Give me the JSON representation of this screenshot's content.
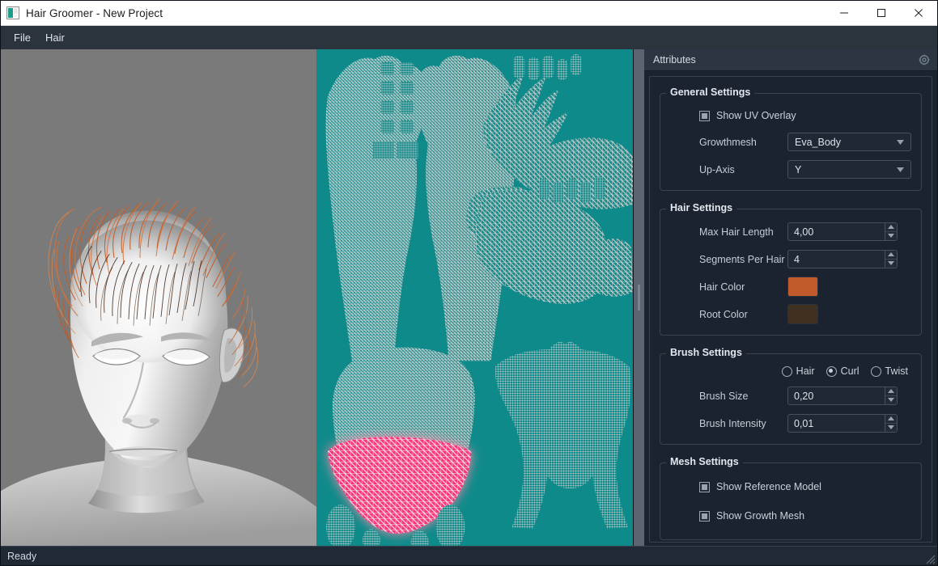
{
  "window": {
    "title": "Hair Groomer - New Project",
    "icon": "app-icon",
    "controls": {
      "minimize": "minimize-icon",
      "maximize": "maximize-icon",
      "close": "close-icon"
    }
  },
  "menubar": {
    "items": [
      {
        "label": "File"
      },
      {
        "label": "Hair"
      }
    ]
  },
  "viewport": {
    "name": "3d-viewport",
    "background_color": "#7a7a7a",
    "model": "female head bust, grayscale clay shading",
    "hair_color": "#c05a2a"
  },
  "uv_panel": {
    "name": "uv-overlay-panel",
    "background_color": "#0e8a8a",
    "wireframe_color": "#d4d4d4",
    "selection_color": "#ff2d78"
  },
  "attributes_dock": {
    "title": "Attributes",
    "gear_icon": "gear-icon",
    "groups": [
      {
        "title": "General Settings",
        "checkboxes": [
          {
            "label": "Show UV Overlay",
            "checked": true
          }
        ],
        "fields": [
          {
            "label": "Growthmesh",
            "type": "combo",
            "value": "Eva_Body"
          },
          {
            "label": "Up-Axis",
            "type": "combo",
            "value": "Y"
          }
        ]
      },
      {
        "title": "Hair Settings",
        "fields": [
          {
            "label": "Max Hair Length",
            "type": "spin",
            "value": "4,00"
          },
          {
            "label": "Segments Per Hair",
            "type": "spin",
            "value": "4"
          },
          {
            "label": "Hair Color",
            "type": "color",
            "value": "#c05a2a"
          },
          {
            "label": "Root Color",
            "type": "color",
            "value": "#40301f"
          }
        ]
      },
      {
        "title": "Brush Settings",
        "radios": [
          {
            "label": "Hair",
            "checked": false
          },
          {
            "label": "Curl",
            "checked": true
          },
          {
            "label": "Twist",
            "checked": false
          }
        ],
        "fields": [
          {
            "label": "Brush Size",
            "type": "spin",
            "value": "0,20"
          },
          {
            "label": "Brush Intensity",
            "type": "spin",
            "value": "0,01"
          }
        ]
      },
      {
        "title": "Mesh Settings",
        "checkboxes": [
          {
            "label": "Show Reference Model",
            "checked": true
          },
          {
            "label": "Show Growth Mesh",
            "checked": true
          }
        ]
      }
    ]
  },
  "statusbar": {
    "text": "Ready"
  }
}
